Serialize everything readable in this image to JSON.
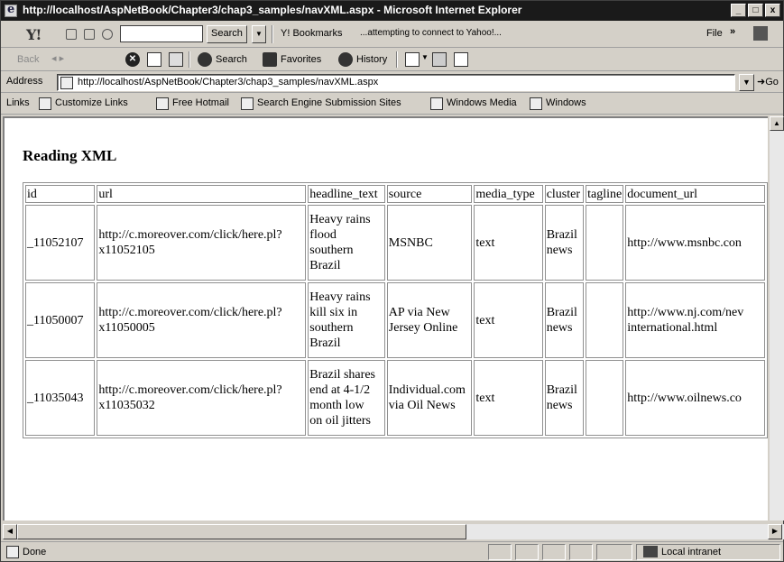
{
  "window": {
    "title": "http://localhost/AspNetBook/Chapter3/chap3_samples/navXML.aspx - Microsoft Internet Explorer",
    "buttons": [
      "_",
      "□",
      "x"
    ]
  },
  "yahoo_bar": {
    "logo": "Y!",
    "search_value": "",
    "search_button": "Search",
    "bookmarks_label": "Y! Bookmarks",
    "status_text": "...attempting to connect to Yahoo!...",
    "file_label": "File",
    "overflow": "»"
  },
  "nav_toolbar": {
    "back_label": "Back",
    "forward_label": "",
    "search_label": "Search",
    "favorites_label": "Favorites",
    "history_label": "History"
  },
  "address_bar": {
    "label": "Address",
    "url": "http://localhost/AspNetBook/Chapter3/chap3_samples/navXML.aspx",
    "go_label": "Go"
  },
  "links_bar": {
    "label": "Links",
    "items": [
      "Customize Links",
      "Free Hotmail",
      "Search Engine Submission Sites",
      "Windows Media",
      "Windows"
    ]
  },
  "page": {
    "heading": "Reading XML",
    "table": {
      "headers": [
        "id",
        "url",
        "headline_text",
        "source",
        "media_type",
        "cluster",
        "tagline",
        "document_url"
      ],
      "rows": [
        {
          "id": "_11052107",
          "url_line1": "http://c.moreover.com/click/here.pl?",
          "url_line2": "x11052105",
          "headline": [
            "Heavy rains",
            "flood",
            "southern",
            "Brazil"
          ],
          "source": [
            "MSNBC"
          ],
          "media_type": "text",
          "cluster": [
            "Brazil",
            "news"
          ],
          "tagline": "",
          "document_url": [
            "http://www.msnbc.con"
          ]
        },
        {
          "id": "_11050007",
          "url_line1": "http://c.moreover.com/click/here.pl?",
          "url_line2": "x11050005",
          "headline": [
            "Heavy rains",
            "kill six in",
            "southern",
            "Brazil"
          ],
          "source": [
            "AP via New",
            "Jersey Online"
          ],
          "media_type": "text",
          "cluster": [
            "Brazil",
            "news"
          ],
          "tagline": "",
          "document_url": [
            "http://www.nj.com/nev",
            "international.html"
          ]
        },
        {
          "id": "_11035043",
          "url_line1": "http://c.moreover.com/click/here.pl?",
          "url_line2": "x11035032",
          "headline": [
            "Brazil shares",
            "end at 4-1/2",
            "month low",
            "on oil jitters"
          ],
          "source": [
            "Individual.com",
            "via Oil News"
          ],
          "media_type": "text",
          "cluster": [
            "Brazil",
            "news"
          ],
          "tagline": "",
          "document_url": [
            "http://www.oilnews.co"
          ]
        }
      ]
    }
  },
  "statusbar": {
    "text": "Done",
    "zone": "Local intranet"
  }
}
